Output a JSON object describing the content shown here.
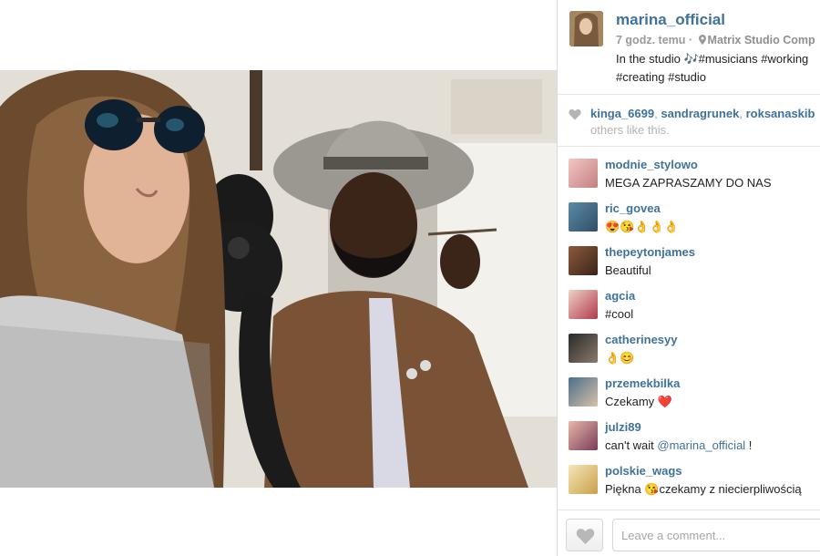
{
  "post": {
    "owner": "marina_official",
    "time": "7 godz. temu",
    "meta_sep": "·",
    "location": "Matrix Studio Comp",
    "caption_line1": "In the studio 🎶#musicians #working",
    "caption_line2": "#creating #studio"
  },
  "likes": {
    "liker1": "kinga_6699",
    "liker2": "sandragrunek",
    "liker3": "roksanaskib",
    "sep": ",",
    "tail": "others like this."
  },
  "comments": [
    {
      "user": "modnie_stylowo",
      "text": "MEGA ZAPRASZAMY DO NAS"
    },
    {
      "user": "ric_govea",
      "text": "😍😘👌👌👌"
    },
    {
      "user": "thepeytonjames",
      "text": "Beautiful"
    },
    {
      "user": "agcia",
      "text": "#cool"
    },
    {
      "user": "catherinesyy",
      "text": "👌😊"
    },
    {
      "user": "przemekbilka",
      "text": "Czekamy ❤️"
    },
    {
      "user": "julzi89",
      "text_before": "can't wait ",
      "mention": "@marina_official",
      "text_after": " !"
    },
    {
      "user": "polskie_wags",
      "text": "Piękna 😘czekamy z niecierpliwością"
    }
  ],
  "footer": {
    "comment_placeholder": "Leave a comment..."
  },
  "colors": {
    "link": "#3f729b",
    "muted": "#999999",
    "border": "#e6e6e6"
  },
  "icons": {
    "location": "pin-icon",
    "like_indicator": "heart-icon",
    "like_button": "heart-icon"
  }
}
